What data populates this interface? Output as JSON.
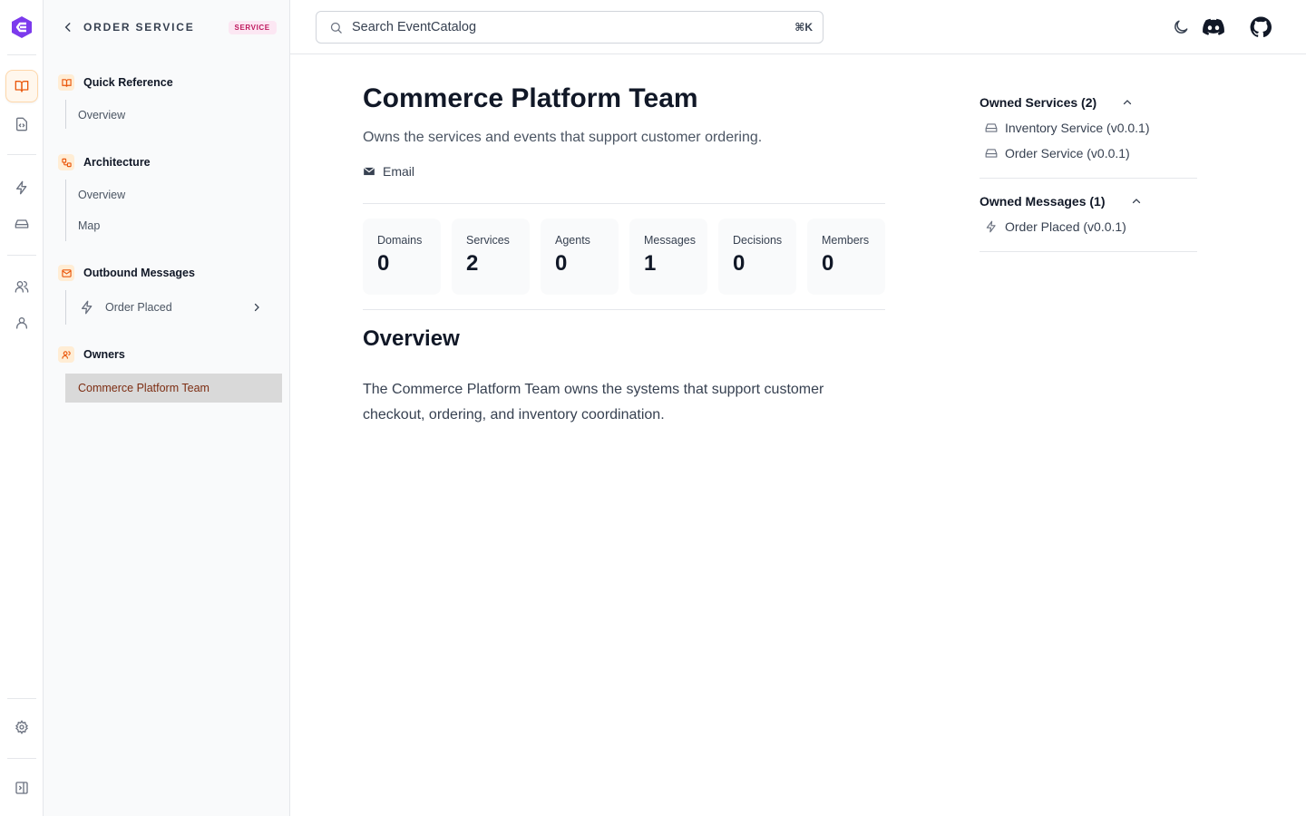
{
  "rail": {
    "items": [
      "docs-icon",
      "api-file-icon",
      "events-icon",
      "services-icon",
      "teams-icon",
      "user-icon",
      "settings-icon",
      "collapse-icon"
    ]
  },
  "sidebar": {
    "title": "ORDER SERVICE",
    "badge": "SERVICE",
    "sections": {
      "quick_reference": {
        "title": "Quick Reference",
        "items": [
          "Overview"
        ]
      },
      "architecture": {
        "title": "Architecture",
        "items": [
          "Overview",
          "Map"
        ]
      },
      "outbound": {
        "title": "Outbound Messages",
        "items": [
          "Order Placed"
        ]
      },
      "owners": {
        "title": "Owners",
        "items": [
          "Commerce Platform Team"
        ]
      }
    }
  },
  "topbar": {
    "search_placeholder": "Search EventCatalog",
    "search_shortcut": "⌘K"
  },
  "main": {
    "title": "Commerce Platform Team",
    "subtitle": "Owns the services and events that support customer ordering.",
    "email_label": "Email",
    "stats": [
      {
        "label": "Domains",
        "value": "0"
      },
      {
        "label": "Services",
        "value": "2"
      },
      {
        "label": "Agents",
        "value": "0"
      },
      {
        "label": "Messages",
        "value": "1"
      },
      {
        "label": "Decisions",
        "value": "0"
      },
      {
        "label": "Members",
        "value": "0"
      }
    ],
    "overview_heading": "Overview",
    "overview_text": "The Commerce Platform Team owns the systems that support customer checkout, ordering, and inventory coordination."
  },
  "right_panel": {
    "owned_services": {
      "title": "Owned Services (2)",
      "items": [
        "Inventory Service (v0.0.1)",
        "Order Service (v0.0.1)"
      ]
    },
    "owned_messages": {
      "title": "Owned Messages (1)",
      "items": [
        "Order Placed (v0.0.1)"
      ]
    }
  },
  "colors": {
    "brand": "#7c3aed",
    "accent": "#ea580c",
    "badge_text": "#be185d"
  }
}
